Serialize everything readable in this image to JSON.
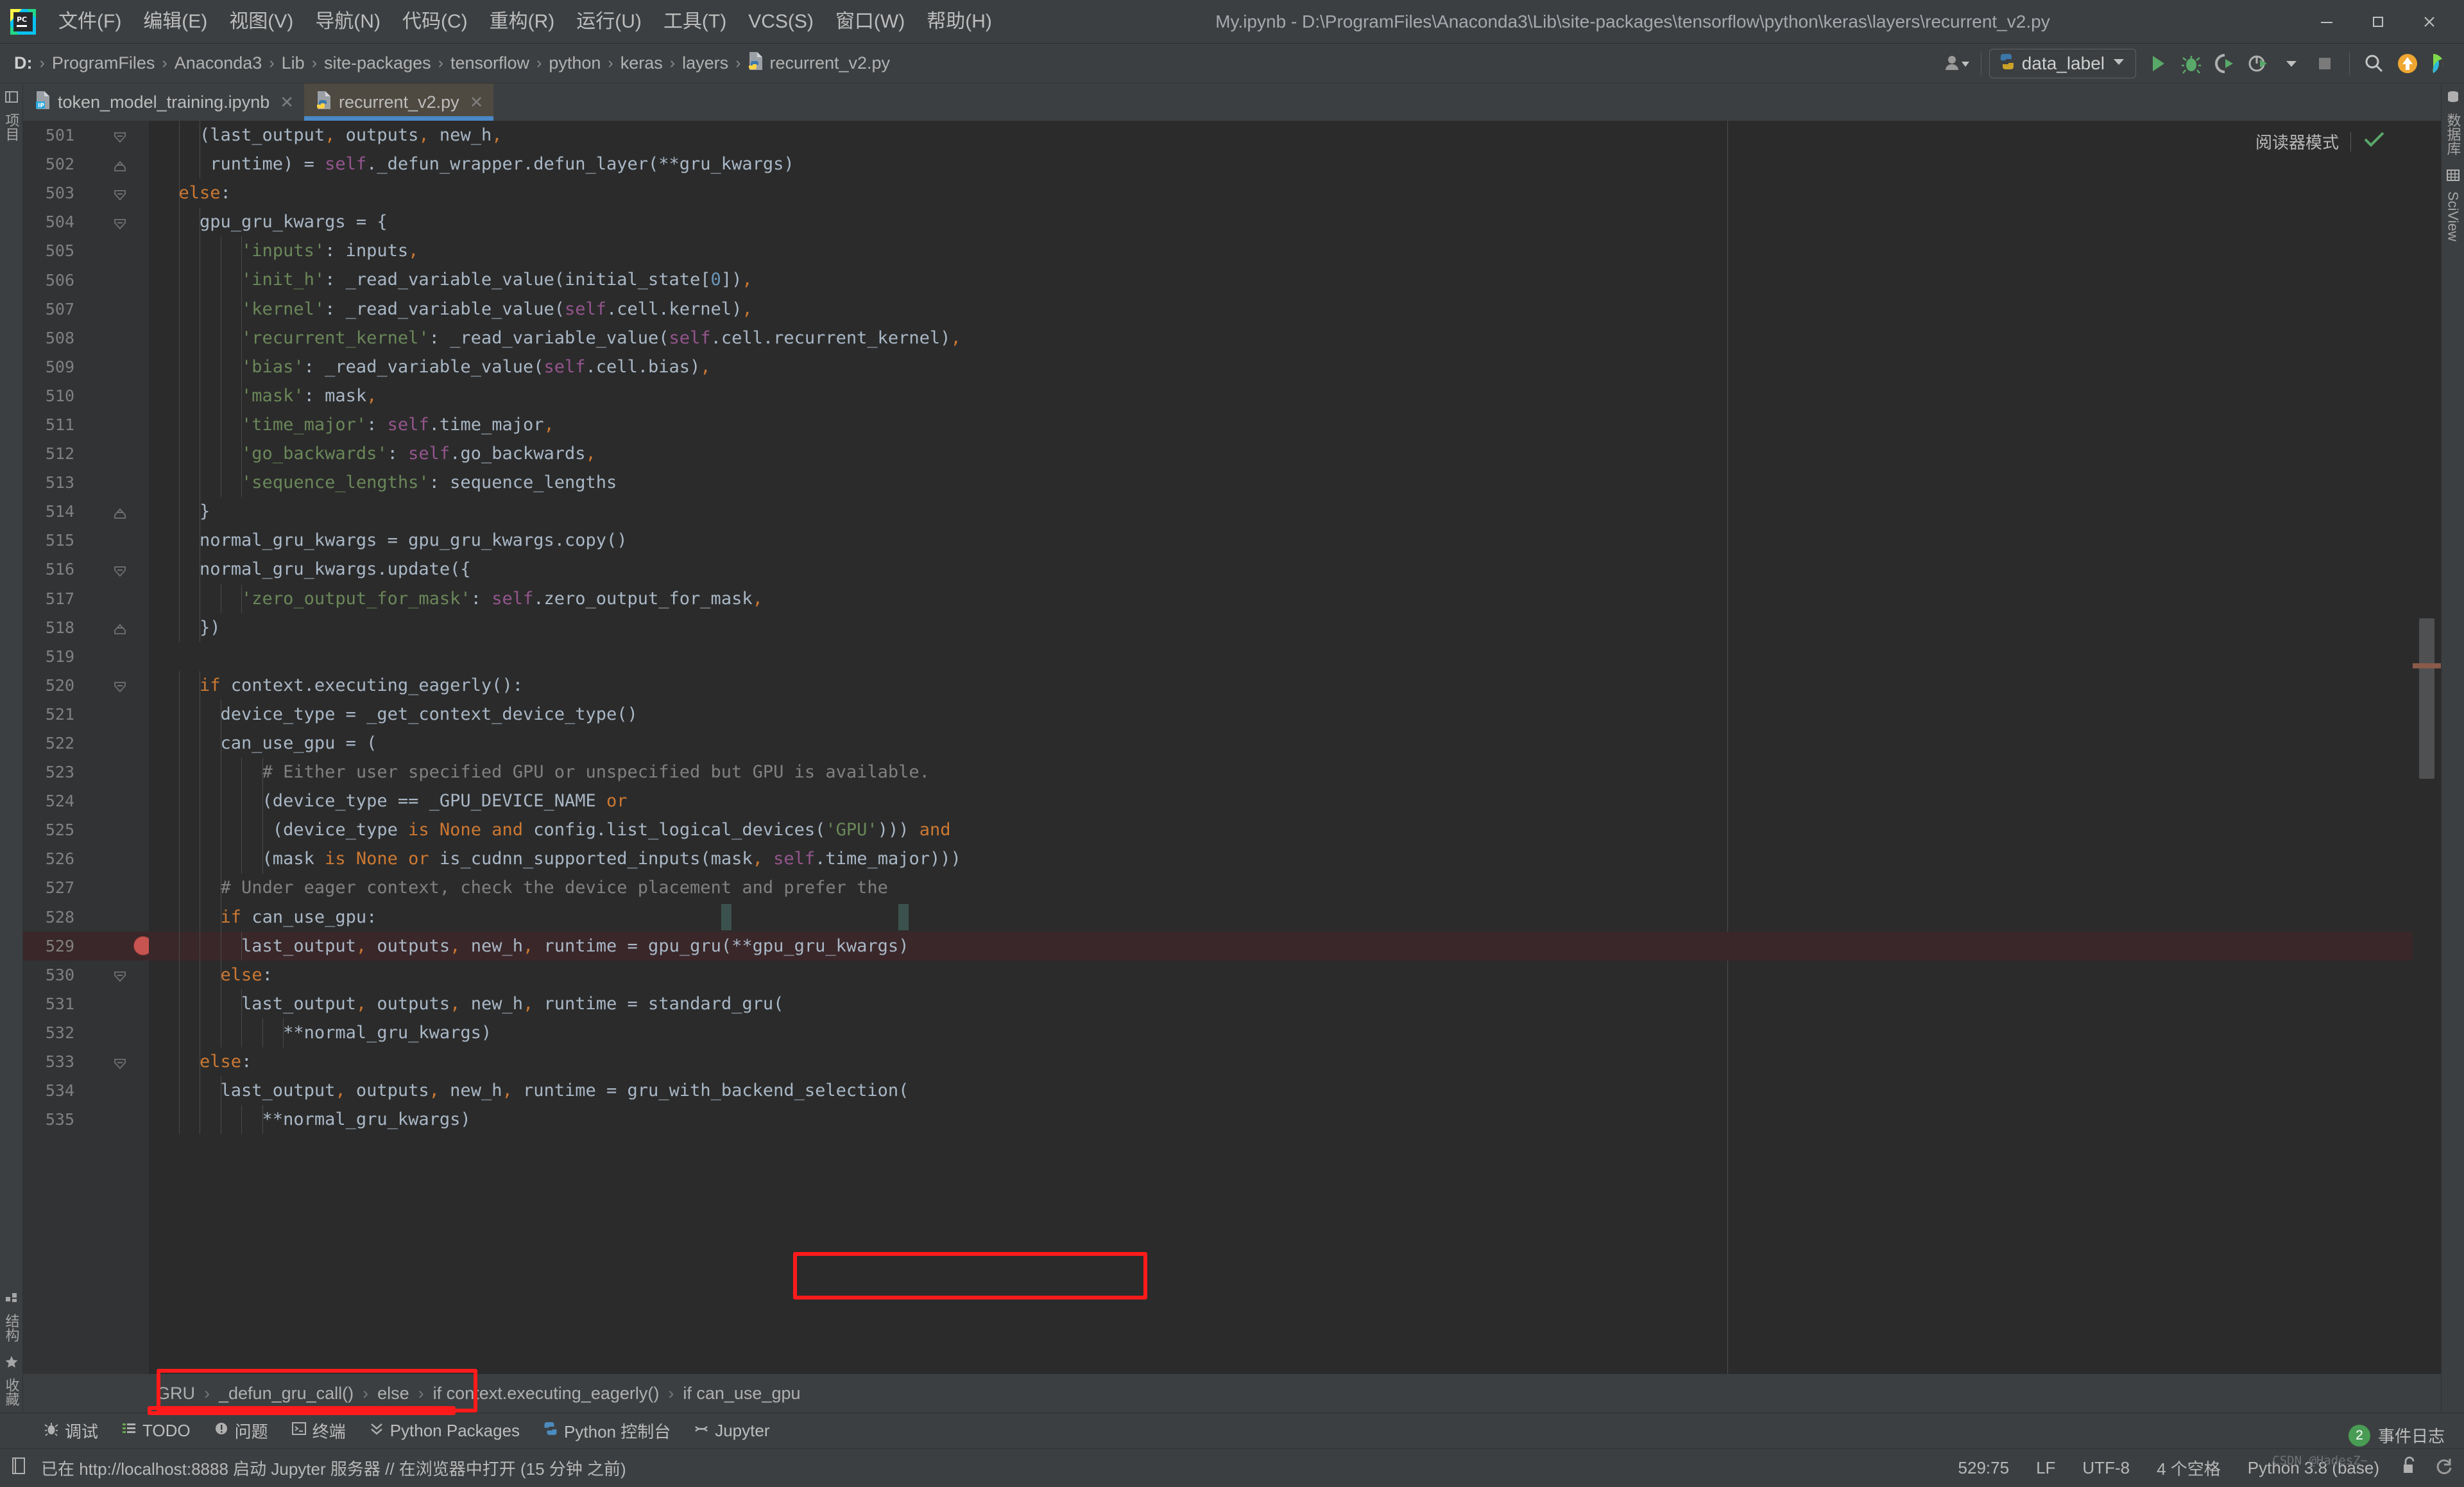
{
  "window": {
    "title": "My.ipynb - D:\\ProgramFiles\\Anaconda3\\Lib\\site-packages\\tensorflow\\python\\keras\\layers\\recurrent_v2.py",
    "minimize_label": "–",
    "maximize_label": "□",
    "close_label": "✕"
  },
  "menu": {
    "items": [
      {
        "label": "文件(F)"
      },
      {
        "label": "编辑(E)"
      },
      {
        "label": "视图(V)"
      },
      {
        "label": "导航(N)"
      },
      {
        "label": "代码(C)"
      },
      {
        "label": "重构(R)"
      },
      {
        "label": "运行(U)"
      },
      {
        "label": "工具(T)"
      },
      {
        "label": "VCS(S)"
      },
      {
        "label": "窗口(W)"
      },
      {
        "label": "帮助(H)"
      }
    ]
  },
  "navbar": {
    "path": [
      "D:",
      "ProgramFiles",
      "Anaconda3",
      "Lib",
      "site-packages",
      "tensorflow",
      "python",
      "keras",
      "layers"
    ],
    "file": "recurrent_v2.py",
    "separator": "›",
    "run_config": "data_label",
    "icons": [
      {
        "name": "user-settings-icon"
      },
      {
        "name": "run-icon"
      },
      {
        "name": "debug-icon"
      },
      {
        "name": "run-coverage-icon"
      },
      {
        "name": "profile-icon"
      },
      {
        "name": "stop-icon"
      },
      {
        "name": "search-everywhere-icon"
      },
      {
        "name": "update-project-icon"
      },
      {
        "name": "datalore-icon"
      }
    ]
  },
  "tabs": [
    {
      "label": "token_model_training.ipynb",
      "icon": "jupyter-notebook-icon",
      "active": false,
      "close": "✕"
    },
    {
      "label": "recurrent_v2.py",
      "icon": "python-file-icon",
      "active": true,
      "close": "✕"
    }
  ],
  "editor": {
    "reader_mode_label": "阅读器模式",
    "reader_mode_check": "✓",
    "first_line_number": 501,
    "lines": [
      {
        "n": 501,
        "fold": "collapse-down",
        "indent": 4,
        "html": "    (last_output, outputs, new_h,"
      },
      {
        "n": 502,
        "fold": "collapse-up",
        "indent": 4,
        "html": "     runtime) = self._defun_wrapper.defun_layer(**gru_kwargs)"
      },
      {
        "n": 503,
        "fold": "collapse-down",
        "indent": 2,
        "html": "  else:"
      },
      {
        "n": 504,
        "fold": "collapse-down",
        "indent": 4,
        "html": "    gpu_gru_kwargs = {"
      },
      {
        "n": 505,
        "fold": "",
        "indent": 8,
        "html": "        'inputs': inputs,"
      },
      {
        "n": 506,
        "fold": "",
        "indent": 8,
        "html": "        'init_h': _read_variable_value(initial_state[0]),"
      },
      {
        "n": 507,
        "fold": "",
        "indent": 8,
        "html": "        'kernel': _read_variable_value(self.cell.kernel),"
      },
      {
        "n": 508,
        "fold": "",
        "indent": 8,
        "html": "        'recurrent_kernel': _read_variable_value(self.cell.recurrent_kernel),"
      },
      {
        "n": 509,
        "fold": "",
        "indent": 8,
        "html": "        'bias': _read_variable_value(self.cell.bias),"
      },
      {
        "n": 510,
        "fold": "",
        "indent": 8,
        "html": "        'mask': mask,"
      },
      {
        "n": 511,
        "fold": "",
        "indent": 8,
        "html": "        'time_major': self.time_major,"
      },
      {
        "n": 512,
        "fold": "",
        "indent": 8,
        "html": "        'go_backwards': self.go_backwards,"
      },
      {
        "n": 513,
        "fold": "",
        "indent": 8,
        "html": "        'sequence_lengths': sequence_lengths"
      },
      {
        "n": 514,
        "fold": "collapse-up",
        "indent": 4,
        "html": "    }"
      },
      {
        "n": 515,
        "fold": "",
        "indent": 4,
        "html": "    normal_gru_kwargs = gpu_gru_kwargs.copy()"
      },
      {
        "n": 516,
        "fold": "collapse-down",
        "indent": 4,
        "html": "    normal_gru_kwargs.update({"
      },
      {
        "n": 517,
        "fold": "",
        "indent": 8,
        "html": "        'zero_output_for_mask': self.zero_output_for_mask,"
      },
      {
        "n": 518,
        "fold": "collapse-up",
        "indent": 4,
        "html": "    })"
      },
      {
        "n": 519,
        "fold": "",
        "indent": 0,
        "html": ""
      },
      {
        "n": 520,
        "fold": "collapse-down",
        "indent": 4,
        "html": "    if context.executing_eagerly():"
      },
      {
        "n": 521,
        "fold": "",
        "indent": 6,
        "html": "      device_type = _get_context_device_type()"
      },
      {
        "n": 522,
        "fold": "",
        "indent": 6,
        "html": "      can_use_gpu = ("
      },
      {
        "n": 523,
        "fold": "",
        "indent": 10,
        "html": "          # Either user specified GPU or unspecified but GPU is available."
      },
      {
        "n": 524,
        "fold": "",
        "indent": 10,
        "html": "          (device_type == _GPU_DEVICE_NAME or"
      },
      {
        "n": 525,
        "fold": "",
        "indent": 11,
        "html": "           (device_type is None and config.list_logical_devices('GPU'))) and"
      },
      {
        "n": 526,
        "fold": "",
        "indent": 10,
        "html": "          (mask is None or is_cudnn_supported_inputs(mask, self.time_major)))"
      },
      {
        "n": 527,
        "fold": "",
        "indent": 6,
        "html": "      # Under eager context, check the device placement and prefer the"
      },
      {
        "n": 528,
        "fold": "",
        "indent": 6,
        "html": "      if can_use_gpu:"
      },
      {
        "n": 529,
        "fold": "",
        "indent": 8,
        "html": "        last_output, outputs, new_h, runtime = gpu_gru(**gpu_gru_kwargs)",
        "current": true,
        "breakpoint": true,
        "bulb": true
      },
      {
        "n": 530,
        "fold": "collapse-down",
        "indent": 6,
        "html": "      else:"
      },
      {
        "n": 531,
        "fold": "",
        "indent": 8,
        "html": "        last_output, outputs, new_h, runtime = standard_gru("
      },
      {
        "n": 532,
        "fold": "",
        "indent": 12,
        "html": "            **normal_gru_kwargs)"
      },
      {
        "n": 533,
        "fold": "collapse-down",
        "indent": 4,
        "html": "    else:"
      },
      {
        "n": 534,
        "fold": "",
        "indent": 6,
        "html": "      last_output, outputs, new_h, runtime = gru_with_backend_selection("
      },
      {
        "n": 535,
        "fold": "",
        "indent": 10,
        "html": "          **normal_gru_kwargs)"
      }
    ],
    "annotation_code_text": "gpu_gru(**gpu_gru_kwargs)"
  },
  "breadcrumb": {
    "separator": "›",
    "items": [
      {
        "label": "GRU",
        "boxed": true
      },
      {
        "label": "_defun_gru_call()",
        "boxed": true
      },
      {
        "label": "else",
        "boxed": false
      },
      {
        "label": "if context.executing_eagerly()",
        "boxed": false
      },
      {
        "label": "if can_use_gpu",
        "boxed": false
      }
    ]
  },
  "left_strip": [
    {
      "label": "项目",
      "icon": "project-icon"
    },
    {
      "label": "结构",
      "icon": "structure-icon"
    },
    {
      "label": "收藏",
      "icon": "favorites-icon"
    }
  ],
  "right_strip": [
    {
      "label": "数据库",
      "icon": "database-icon"
    },
    {
      "label": "SciView",
      "icon": "sciview-icon"
    }
  ],
  "tool_windows": [
    {
      "label": "调试",
      "icon": "debug-icon"
    },
    {
      "label": "TODO",
      "icon": "todo-icon"
    },
    {
      "label": "问题",
      "icon": "problems-icon"
    },
    {
      "label": "终端",
      "icon": "terminal-icon"
    },
    {
      "label": "Python Packages",
      "icon": "packages-icon"
    },
    {
      "label": "Python 控制台",
      "icon": "python-console-icon"
    },
    {
      "label": "Jupyter",
      "icon": "jupyter-icon"
    }
  ],
  "event_log": {
    "label": "事件日志",
    "count": "2"
  },
  "statusbar": {
    "message": "已在 http://localhost:8888 启动 Jupyter 服务器 // 在浏览器中打开 (15 分钟 之前)",
    "caret": "529:75",
    "line_separator": "LF",
    "encoding": "UTF-8",
    "indent": "4 个空格",
    "interpreter": "Python 3.8 (base)",
    "lock_icon": "unlocked-icon",
    "sync_icon": "sync-icon"
  },
  "watermark": "CSDN @HadesZ~",
  "colors": {
    "accent_blue": "#4a88c7",
    "annotation_red": "#ff1b1b",
    "breakpoint_red": "#c75450",
    "keyword_orange": "#cc7832",
    "string_green": "#6a8759",
    "self_purple": "#94558d",
    "comment_gray": "#808080",
    "text": "#a9b7c6",
    "editor_bg": "#2b2b2b",
    "chrome_bg": "#3c3f41",
    "current_line": "#3a2729",
    "badge_green": "#499c54"
  }
}
